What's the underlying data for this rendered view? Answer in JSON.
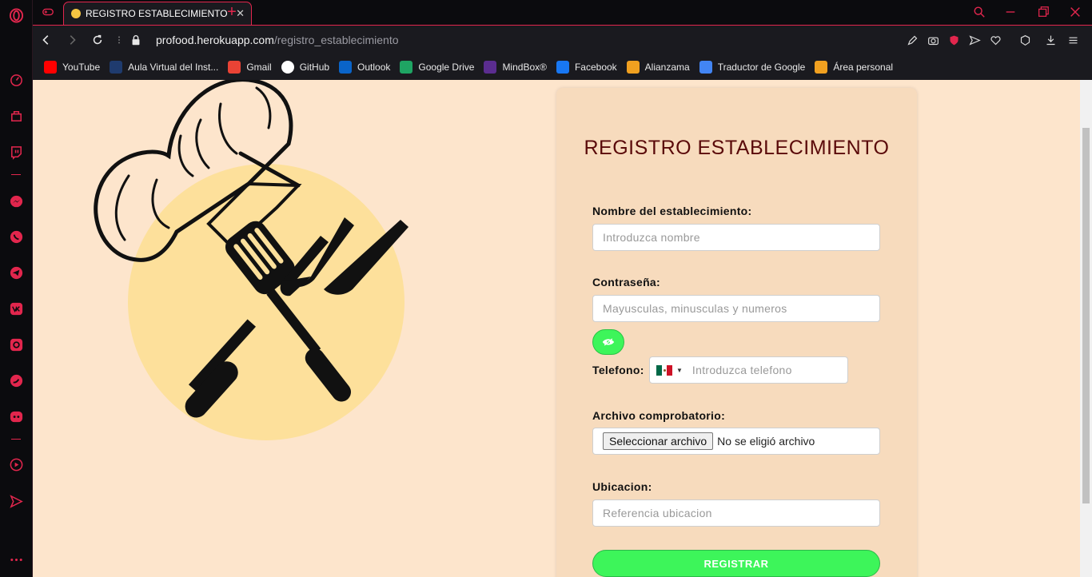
{
  "browser": {
    "tab": {
      "title": "REGISTRO ESTABLECIMIENTO",
      "close": "✕"
    },
    "new_tab": "+",
    "url": {
      "host": "profood.herokuapp.com",
      "path": "/registro_establecimiento"
    },
    "accent_color": "#e2264d",
    "bookmarks": [
      {
        "label": "YouTube",
        "icon": "youtube-icon",
        "color": "#ff0000"
      },
      {
        "label": "Aula Virtual del Inst...",
        "icon": "aula-virtual-icon",
        "color": "#1f3b6e"
      },
      {
        "label": "Gmail",
        "icon": "gmail-icon",
        "color": "#ea4335"
      },
      {
        "label": "GitHub",
        "icon": "github-icon",
        "color": "#ffffff"
      },
      {
        "label": "Outlook",
        "icon": "outlook-icon",
        "color": "#0a64c8"
      },
      {
        "label": "Google Drive",
        "icon": "google-drive-icon",
        "color": "#1fa463"
      },
      {
        "label": "MindBox®",
        "icon": "mindbox-icon",
        "color": "#5b2d90"
      },
      {
        "label": "Facebook",
        "icon": "facebook-icon",
        "color": "#1877f2"
      },
      {
        "label": "Alianzama",
        "icon": "alianzama-icon",
        "color": "#f0a020"
      },
      {
        "label": "Traductor de Google",
        "icon": "google-translate-icon",
        "color": "#4285f4"
      },
      {
        "label": "Área personal",
        "icon": "area-personal-icon",
        "color": "#f0a020"
      }
    ]
  },
  "form": {
    "title": "REGISTRO ESTABLECIMIENTO",
    "name_label": "Nombre del establecimiento:",
    "name_placeholder": "Introduzca nombre",
    "password_label": "Contraseña:",
    "password_placeholder": "Mayusculas, minusculas y numeros",
    "phone_label": "Telefono:",
    "phone_placeholder": "Introduzca telefono",
    "file_label": "Archivo comprobatorio:",
    "file_button": "Seleccionar archivo",
    "file_status": "No se eligió archivo",
    "location_label": "Ubicacion:",
    "location_placeholder": "Referencia ubicacion",
    "submit": "REGISTRAR",
    "submit_color": "#3df55a"
  }
}
